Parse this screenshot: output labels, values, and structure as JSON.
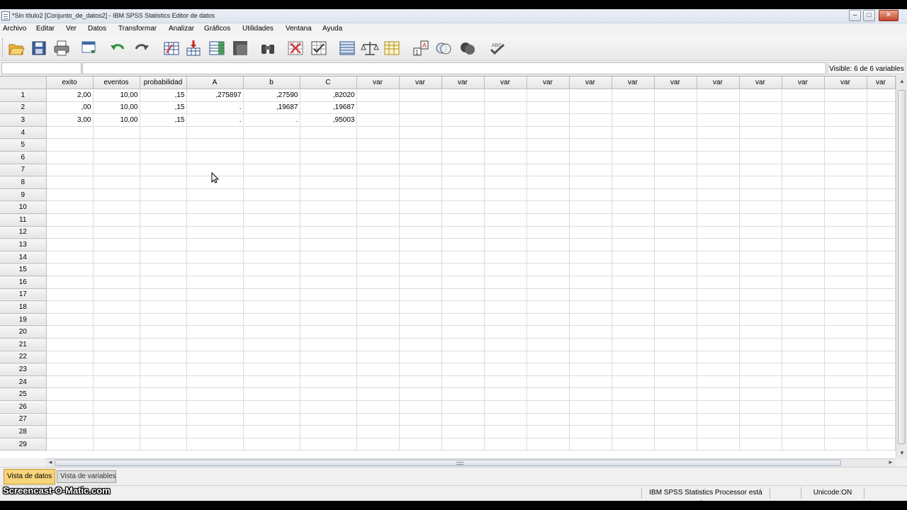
{
  "window": {
    "title": "*Sin título2 [Conjunto_de_datos2] - IBM SPSS Statistics Editor de datos",
    "minimize": "–",
    "maximize": "□",
    "close": "✕"
  },
  "menu": [
    "Archivo",
    "Editar",
    "Ver",
    "Datos",
    "Transformar",
    "Analizar",
    "Gráficos",
    "Utilidades",
    "Ventana",
    "Ayuda"
  ],
  "toolbar": {
    "buttons": [
      {
        "name": "open-icon"
      },
      {
        "name": "save-icon"
      },
      {
        "name": "print-icon"
      },
      {
        "name": "dialog-recall-icon"
      },
      {
        "name": "undo-icon"
      },
      {
        "name": "redo-icon"
      },
      {
        "name": "goto-case-icon"
      },
      {
        "name": "goto-variable-icon"
      },
      {
        "name": "variables-icon"
      },
      {
        "name": "run-descriptives-icon"
      },
      {
        "name": "find-icon"
      },
      {
        "name": "insert-cases-icon"
      },
      {
        "name": "insert-variable-icon"
      },
      {
        "name": "split-file-icon"
      },
      {
        "name": "weight-cases-icon"
      },
      {
        "name": "select-cases-icon"
      },
      {
        "name": "value-labels-icon"
      },
      {
        "name": "use-variable-sets-icon"
      },
      {
        "name": "show-all-variables-icon"
      },
      {
        "name": "spell-check-icon"
      }
    ]
  },
  "editor": {
    "cell_ref": "",
    "cell_value": "",
    "visible": "Visible: 6 de 6 variables"
  },
  "grid": {
    "columns": [
      "exito",
      "eventos",
      "probabilidad",
      "A",
      "b",
      "C",
      "var",
      "var",
      "var",
      "var",
      "var",
      "var",
      "var",
      "var",
      "var",
      "var",
      "var",
      "var",
      "var"
    ],
    "rows": [
      [
        "2,00",
        "10,00",
        ",15",
        ",275897",
        ",27590",
        ",82020"
      ],
      [
        ",00",
        "10,00",
        ",15",
        ".",
        ",19687",
        ",19687"
      ],
      [
        "3,00",
        "10,00",
        ",15",
        ".",
        ".",
        ",95003"
      ]
    ],
    "row_count": 29
  },
  "tabs": {
    "data_view": "Vista de datos",
    "variable_view": "Vista de variables"
  },
  "status": {
    "processor": "IBM SPSS Statistics Processor está listo",
    "unicode": "Unicode:ON"
  },
  "watermark": "Screencast-O-Matic.com",
  "colors": {
    "active_tab": "#f8d47a",
    "header": "#e6e6e6",
    "grid_line": "#dcdcdc"
  }
}
